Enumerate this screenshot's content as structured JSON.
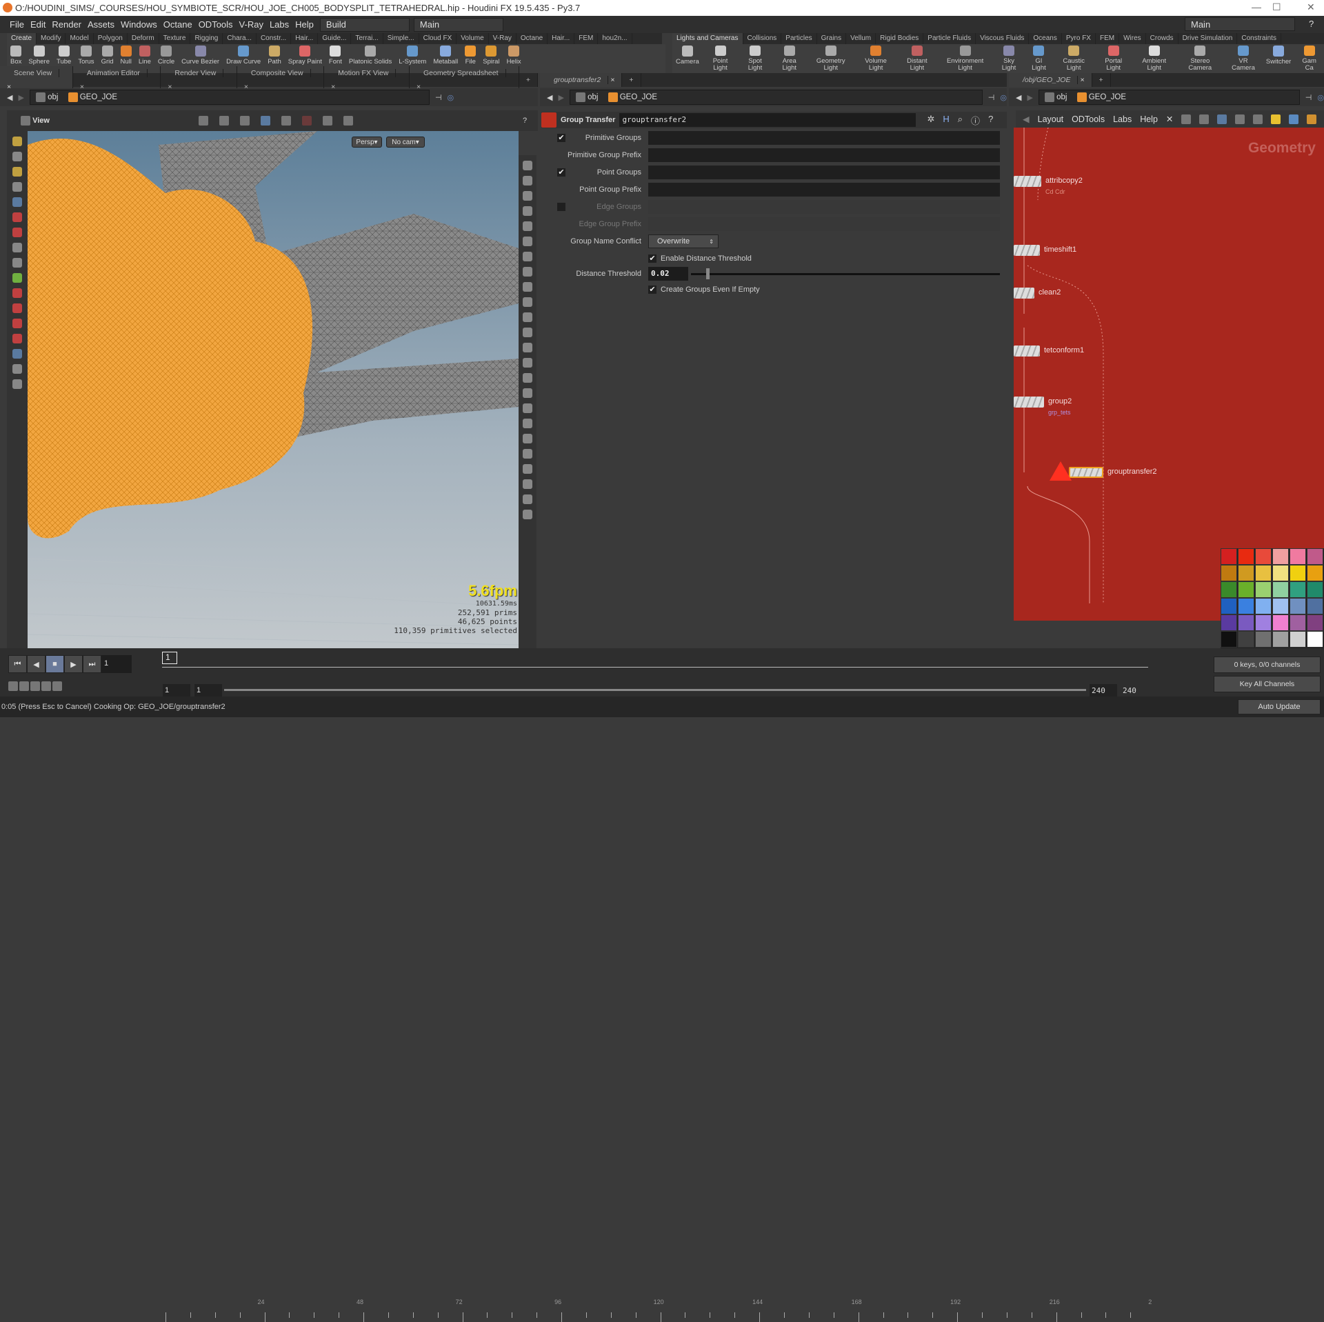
{
  "window": {
    "title": "O:/HOUDINI_SIMS/_COURSES/HOU_SYMBIOTE_SCR/HOU_JOE_CH005_BODYSPLIT_TETRAHEDRAL.hip - Houdini FX 19.5.435 - Py3.7"
  },
  "menu": [
    "File",
    "Edit",
    "Render",
    "Assets",
    "Windows",
    "Octane",
    "ODTools",
    "V-Ray",
    "Labs",
    "Help"
  ],
  "desktop": {
    "build": "Build",
    "main": "Main",
    "main_right": "Main"
  },
  "shelf_left": {
    "tabs": [
      "Create",
      "Modify",
      "Model",
      "Polygon",
      "Deform",
      "Texture",
      "Rigging",
      "Chara...",
      "Constr...",
      "Hair...",
      "Guide...",
      "Terrai...",
      "Simple...",
      "Cloud FX",
      "Volume",
      "V-Ray",
      "Octane",
      "Hair...",
      "FEM",
      "hou2n..."
    ],
    "tools": [
      "Box",
      "Sphere",
      "Tube",
      "Torus",
      "Grid",
      "Null",
      "Line",
      "Circle",
      "Curve Bezier",
      "Draw Curve",
      "Path",
      "Spray Paint",
      "Font",
      "Platonic Solids",
      "L-System",
      "Metaball",
      "File",
      "Spiral",
      "Helix"
    ]
  },
  "shelf_right": {
    "tabs": [
      "Lights and Cameras",
      "Collisions",
      "Particles",
      "Grains",
      "Vellum",
      "Rigid Bodies",
      "Particle Fluids",
      "Viscous Fluids",
      "Oceans",
      "Pyro FX",
      "FEM",
      "Wires",
      "Crowds",
      "Drive Simulation",
      "Constraints"
    ],
    "tools": [
      "Camera",
      "Point Light",
      "Spot Light",
      "Area Light",
      "Geometry Light",
      "Volume Light",
      "Distant Light",
      "Environment Light",
      "Sky Light",
      "GI Light",
      "Caustic Light",
      "Portal Light",
      "Ambient Light",
      "Stereo Camera",
      "VR Camera",
      "Switcher",
      "Gam Ca"
    ]
  },
  "scene_pane": {
    "tabs": [
      "Scene View",
      "Animation Editor",
      "Render View",
      "Composite View",
      "Motion FX View",
      "Geometry Spreadsheet"
    ],
    "path": [
      "obj",
      "GEO_JOE"
    ],
    "view_label": "View",
    "persp": "Persp",
    "cam": "No cam",
    "stats": {
      "fps": "5.6fpm",
      "ms": "10631.59ms",
      "prims": "252,591  prims",
      "points": "46,625 points",
      "selected": "110,359 primitives selected"
    }
  },
  "param_pane": {
    "tab": "grouptransfer2",
    "path": [
      "obj",
      "GEO_JOE"
    ],
    "node_type": "Group Transfer",
    "node_name": "grouptransfer2",
    "params": [
      {
        "label": "Primitive Groups",
        "checked": true,
        "enabled": true,
        "value": ""
      },
      {
        "label": "Primitive Group Prefix",
        "enabled": true,
        "value": ""
      },
      {
        "label": "Point Groups",
        "checked": true,
        "enabled": true,
        "value": ""
      },
      {
        "label": "Point Group Prefix",
        "enabled": true,
        "value": ""
      },
      {
        "label": "Edge Groups",
        "checked": false,
        "enabled": false,
        "value": ""
      },
      {
        "label": "Edge Group Prefix",
        "enabled": false,
        "value": ""
      }
    ],
    "group_name_conflict": {
      "label": "Group Name Conflict",
      "value": "Overwrite"
    },
    "enable_distance": {
      "label": "Enable Distance Threshold",
      "checked": true
    },
    "distance": {
      "label": "Distance Threshold",
      "value": "0.02",
      "slider_fraction": 0.05
    },
    "create_empty": {
      "label": "Create Groups Even If Empty",
      "checked": true
    }
  },
  "network_pane": {
    "tab": "/obj/GEO_JOE",
    "path": [
      "obj",
      "GEO_JOE"
    ],
    "menu": [
      "Layout",
      "ODTools",
      "Labs",
      "Help"
    ],
    "context_label": "Geometry",
    "bg_color": "#a8271e",
    "nodes": [
      {
        "name": "attribcopy2",
        "sub": "Cd Cdr"
      },
      {
        "name": "timeshift1",
        "sub": ""
      },
      {
        "name": "clean2",
        "sub": ""
      },
      {
        "name": "tetconform1",
        "sub": ""
      },
      {
        "name": "group2",
        "sub": "grp_tets"
      },
      {
        "name": "grouptransfer2",
        "sub": "",
        "error": true
      }
    ]
  },
  "palette": [
    "#d42020",
    "#e82a10",
    "#e84a3a",
    "#f0a0a0",
    "#f07aa0",
    "#c05a8a",
    "#c07a10",
    "#d09a20",
    "#e8c040",
    "#f0e080",
    "#f0d010",
    "#e8a010",
    "#3a8a2a",
    "#6ab02a",
    "#9ad070",
    "#90d0a0",
    "#30a080",
    "#208a6a",
    "#2060c0",
    "#3a80e0",
    "#80b0f0",
    "#a0c0f0",
    "#7090c0",
    "#5070a0",
    "#5a3aa0",
    "#7a5ac0",
    "#a080e0",
    "#f080d0",
    "#a060a0",
    "#804080",
    "#101010",
    "#404040",
    "#707070",
    "#a0a0a0",
    "#d0d0d0",
    "#ffffff"
  ],
  "timeline": {
    "current_frame": "1",
    "frame_marker": "1",
    "ticks": [
      "24",
      "48",
      "72",
      "96",
      "120",
      "144",
      "168",
      "192",
      "216",
      "2"
    ],
    "start": "1",
    "start2": "1",
    "end": "240",
    "end2": "240",
    "keys": "0 keys, 0/0 channels",
    "key_all": "Key All Channels"
  },
  "status": {
    "message": "0:05 (Press Esc to Cancel) Cooking Op:  GEO_JOE/grouptransfer2",
    "auto_update": "Auto Update"
  }
}
